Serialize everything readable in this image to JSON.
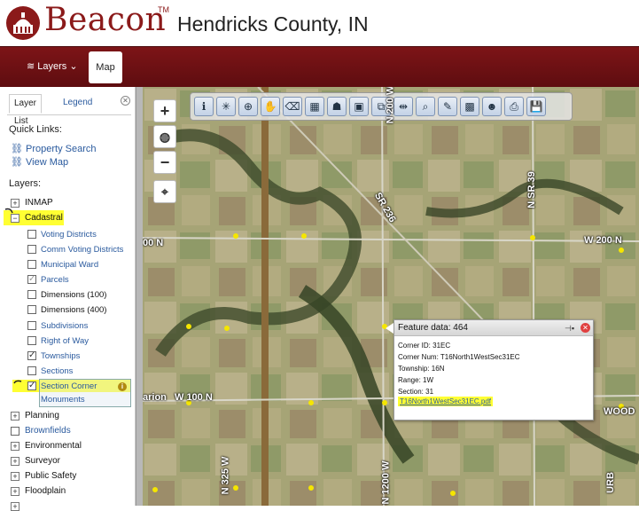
{
  "header": {
    "brand": "Beacon",
    "tm": "TM",
    "county": "Hendricks County, IN"
  },
  "nav": {
    "layers_label": "Layers",
    "map_label": "Map"
  },
  "sidebar": {
    "tabs": [
      "Layer List",
      "Legend"
    ],
    "quick_links_title": "Quick Links:",
    "quick_links": [
      "Property Search",
      "View Map"
    ],
    "layers_title": "Layers:",
    "top_layers": [
      {
        "label": "INMAP",
        "state": "+"
      },
      {
        "label": "Cadastral",
        "state": "−"
      }
    ],
    "cadastral_items": [
      {
        "label": "Voting Districts",
        "checked": false
      },
      {
        "label": "Comm Voting Districts",
        "checked": false
      },
      {
        "label": "Municipal Ward",
        "checked": false
      },
      {
        "label": "Parcels",
        "checked": true
      },
      {
        "label": "Dimensions (100)",
        "checked": false
      },
      {
        "label": "Dimensions (400)",
        "checked": false
      },
      {
        "label": "Subdivisions",
        "checked": false
      },
      {
        "label": "Right of Way",
        "checked": false
      },
      {
        "label": "Townships",
        "checked": true
      },
      {
        "label": "Sections",
        "checked": false
      },
      {
        "label": "Section Corner",
        "checked": true
      },
      {
        "label": "Monuments",
        "checked": true
      }
    ],
    "bottom_layers": [
      {
        "label": "Planning",
        "type": "plus"
      },
      {
        "label": "Brownfields",
        "type": "check"
      },
      {
        "label": "Environmental",
        "type": "plus"
      },
      {
        "label": "Surveyor",
        "type": "plus"
      },
      {
        "label": "Public Safety",
        "type": "plus"
      },
      {
        "label": "Floodplain",
        "type": "plus"
      }
    ]
  },
  "map": {
    "road_labels": [
      "N 200 W",
      "N SR 39",
      "SR 236",
      "W 200 N",
      "00 N",
      "arion",
      "W 100 N",
      "N 325 W",
      "N 1200 W",
      "WOOD",
      "URB"
    ],
    "popup": {
      "title": "Feature data: 464",
      "corner_id": "Corner ID: 31EC",
      "corner_num": "Corner Num: T16North1WestSec31EC",
      "township": "Township: 16N",
      "range": "Range: 1W",
      "section": "Section: 31",
      "link": "T16North1WestSec31EC.pdf"
    },
    "highlight_color": "#ffff33",
    "accent_color": "#7d1417"
  }
}
